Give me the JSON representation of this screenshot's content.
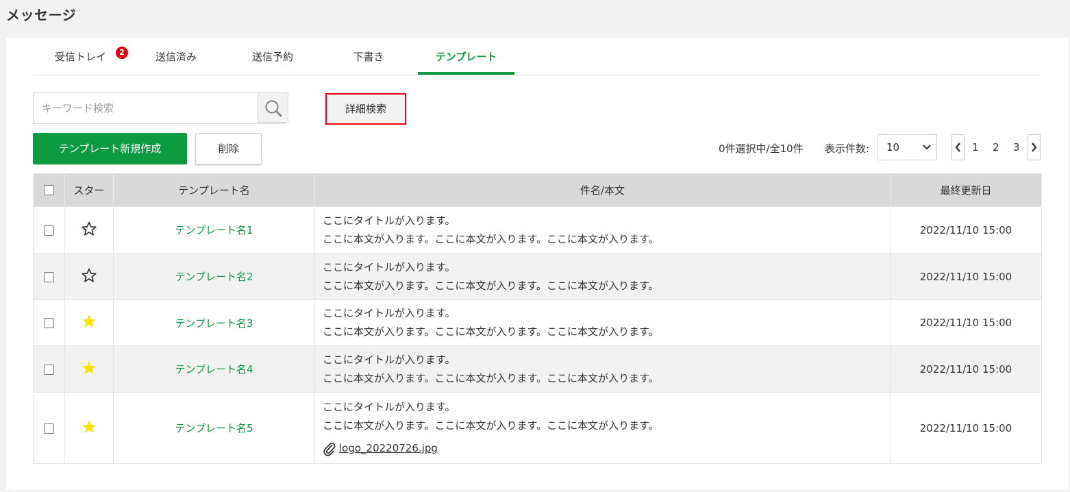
{
  "page": {
    "title": "メッセージ"
  },
  "tabs": [
    {
      "label": "受信トレイ",
      "badge": "2"
    },
    {
      "label": "送信済み"
    },
    {
      "label": "送信予約"
    },
    {
      "label": "下書き"
    },
    {
      "label": "テンプレート",
      "active": true
    }
  ],
  "search": {
    "placeholder": "キーワード検索",
    "value": "",
    "advanced_label": "詳細検索"
  },
  "actions": {
    "create_label": "テンプレート新規作成",
    "delete_label": "削除"
  },
  "selection": {
    "text": "0件選択中/全10件"
  },
  "per_page": {
    "label": "表示件数:",
    "value": "10"
  },
  "pagination": {
    "pages": [
      "1",
      "2",
      "3"
    ]
  },
  "table": {
    "headers": {
      "star": "スター",
      "name": "テンプレート名",
      "subject": "件名/本文",
      "updated": "最終更新日"
    },
    "rows": [
      {
        "starred": false,
        "name": "テンプレート名1",
        "title": "ここにタイトルが入ります。",
        "body": "ここに本文が入ります。ここに本文が入ります。ここに本文が入ります。",
        "updated": "2022/11/10 15:00"
      },
      {
        "starred": false,
        "name": "テンプレート名2",
        "title": "ここにタイトルが入ります。",
        "body": "ここに本文が入ります。ここに本文が入ります。ここに本文が入ります。",
        "updated": "2022/11/10 15:00"
      },
      {
        "starred": true,
        "name": "テンプレート名3",
        "title": "ここにタイトルが入ります。",
        "body": "ここに本文が入ります。ここに本文が入ります。ここに本文が入ります。",
        "updated": "2022/11/10 15:00"
      },
      {
        "starred": true,
        "name": "テンプレート名4",
        "title": "ここにタイトルが入ります。",
        "body": "ここに本文が入ります。ここに本文が入ります。ここに本文が入ります。",
        "updated": "2022/11/10 15:00"
      },
      {
        "starred": true,
        "name": "テンプレート名5",
        "title": "ここにタイトルが入ります。",
        "body": "ここに本文が入ります。ここに本文が入ります。ここに本文が入ります。",
        "attachment": "logo_20220726.jpg",
        "updated": "2022/11/10 15:00"
      }
    ]
  },
  "colors": {
    "accent": "#0e9a43",
    "badge": "#e60012",
    "star_filled": "#f5e600",
    "highlight_border": "#e60012"
  }
}
